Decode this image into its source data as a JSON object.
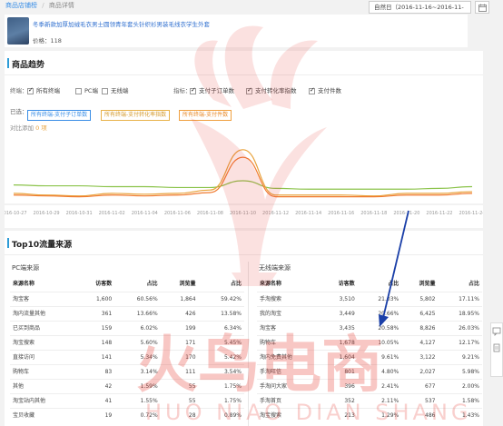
{
  "breadcrumb": {
    "home": "商品店铺榜",
    "sep": "/",
    "current": "商品详情"
  },
  "date_range": "自然日（2016-11-16~2016-11-16）",
  "product": {
    "title": "冬季新款加厚加绒毛衣男士圆领青年套头针织衫男装毛线衣学生外套",
    "price": "价格：118"
  },
  "trend": {
    "title": "商品趋势",
    "terminal_label": "终端：",
    "terminals": [
      {
        "label": "所有终端",
        "checked": true
      },
      {
        "label": "PC端",
        "checked": false
      },
      {
        "label": "无线端",
        "checked": false
      }
    ],
    "metric_label": "指标：",
    "metrics": [
      {
        "label": "支付子订单数",
        "checked": true
      },
      {
        "label": "支付转化率指数",
        "checked": true
      },
      {
        "label": "支付件数",
        "checked": true
      }
    ],
    "selected_label": "已选：",
    "selected": [
      {
        "label": "所有终端-支付子订单数",
        "color": "#4aa3e0"
      },
      {
        "label": "所有终端-支付转化率指数",
        "color": "#e8b24a"
      },
      {
        "label": "所有终端-支付件数",
        "color": "#f0a040"
      }
    ],
    "compare_label": "对比添加",
    "compare_count": "0 项"
  },
  "chart_data": {
    "type": "line",
    "x": [
      "2016-10-27",
      "2016-10-29",
      "2016-10-31",
      "2016-11-02",
      "2016-11-04",
      "2016-11-06",
      "2016-11-08",
      "2016-11-10",
      "2016-11-12",
      "2016-11-14",
      "2016-11-16",
      "2016-11-18",
      "2016-11-20",
      "2016-11-22",
      "2016-11-24"
    ],
    "series": [
      {
        "values": [
          22,
          21,
          21,
          20,
          20,
          19,
          19,
          27,
          18,
          17,
          17,
          17,
          17,
          18,
          20
        ]
      },
      {
        "values": [
          12,
          10,
          9,
          12,
          11,
          12,
          16,
          64,
          10,
          10,
          10,
          9,
          12,
          12,
          14
        ]
      },
      {
        "values": [
          10,
          9,
          8,
          10,
          9,
          10,
          13,
          55,
          8,
          8,
          8,
          8,
          10,
          10,
          12
        ]
      }
    ],
    "colors": [
      "#8bc34a",
      "#e8a33d",
      "#f07a30"
    ],
    "ylim": [
      0,
      80
    ]
  },
  "top10": {
    "title": "Top10流量来源",
    "pc": {
      "heading": "PC端来源",
      "columns": [
        "来源名称",
        "访客数",
        "占比",
        "浏览量",
        "占比"
      ],
      "rows": [
        [
          "淘宝客",
          "1,600",
          "60.56%",
          "1,864",
          "59.42%"
        ],
        [
          "淘内流量其他",
          "361",
          "13.66%",
          "426",
          "13.58%"
        ],
        [
          "已买到商品",
          "159",
          "6.02%",
          "199",
          "6.34%"
        ],
        [
          "淘宝搜索",
          "148",
          "5.60%",
          "171",
          "5.45%"
        ],
        [
          "直接访问",
          "141",
          "5.34%",
          "170",
          "5.42%"
        ],
        [
          "购物车",
          "83",
          "3.14%",
          "111",
          "3.54%"
        ],
        [
          "其他",
          "42",
          "1.59%",
          "55",
          "1.75%"
        ],
        [
          "淘宝站内其他",
          "41",
          "1.55%",
          "55",
          "1.75%"
        ],
        [
          "宝贝收藏",
          "19",
          "0.72%",
          "28",
          "0.89%"
        ]
      ]
    },
    "wireless": {
      "heading": "无线端来源",
      "columns": [
        "来源名称",
        "访客数",
        "占比",
        "浏览量",
        "占比"
      ],
      "rows": [
        [
          "手淘搜索",
          "3,510",
          "21.03%",
          "5,802",
          "17.11%"
        ],
        [
          "我的淘宝",
          "3,449",
          "20.66%",
          "6,425",
          "18.95%"
        ],
        [
          "淘宝客",
          "3,435",
          "20.58%",
          "8,826",
          "26.03%"
        ],
        [
          "购物车",
          "1,678",
          "10.05%",
          "4,127",
          "12.17%"
        ],
        [
          "淘内免费其他",
          "1,604",
          "9.61%",
          "3,122",
          "9.21%"
        ],
        [
          "手淘旺信",
          "801",
          "4.80%",
          "2,027",
          "5.98%"
        ],
        [
          "手淘问大家",
          "396",
          "2.41%",
          "677",
          "2.00%"
        ],
        [
          "手淘首页",
          "352",
          "2.11%",
          "537",
          "1.58%"
        ],
        [
          "淘宝搜索",
          "213",
          "1.29%",
          "486",
          "1.43%"
        ]
      ]
    }
  },
  "watermark": {
    "brand_cn": "火鸟电商",
    "brand_en": "HUO NIAO DIAN SHANG",
    "color": "#e8453c"
  }
}
